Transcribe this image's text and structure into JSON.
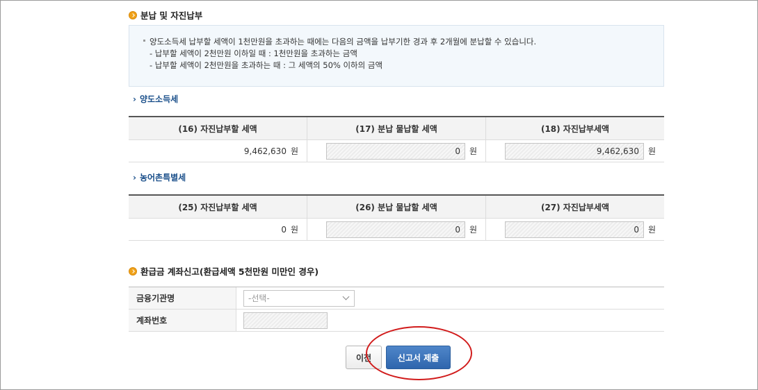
{
  "installment": {
    "title": "분납 및 자진납부",
    "info_line1": "양도소득세 납부할 세액이 1천만원을 초과하는 때에는 다음의 금액을 납부기한 경과 후 2개월에 분납할 수 있습니다.",
    "info_line2": "- 납부할 세액이 2천만원 이하일 때 : 1천만원을 초과하는 금액",
    "info_line3": "- 납부할 세액이 2천만원을 초과하는 때 : 그 세액의 50% 이하의 금액"
  },
  "transfer_tax": {
    "title": "양도소득세",
    "headers": [
      "(16) 자진납부할 세액",
      "(17) 분납 물납할 세액",
      "(18) 자진납부세액"
    ],
    "values": [
      "9,462,630",
      "0",
      "9,462,630"
    ],
    "unit": "원"
  },
  "rural_tax": {
    "title": "농어촌특별세",
    "headers": [
      "(25) 자진납부할 세액",
      "(26) 분납 물납할 세액",
      "(27) 자진납부세액"
    ],
    "values": [
      "0",
      "0",
      "0"
    ],
    "unit": "원"
  },
  "refund": {
    "title": "환급금 계좌신고(환급세액 5천만원 미만인 경우)",
    "bank_label": "금융기관명",
    "bank_selected": "-선택-",
    "account_label": "계좌번호",
    "account_value": ""
  },
  "buttons": {
    "prev": "이전",
    "submit": "신고서 제출"
  },
  "colors": {
    "accent": "#2f66ad",
    "highlight": "#d11b1b",
    "bullet": "#f0a21a",
    "subtitle": "#1a4f8a"
  }
}
